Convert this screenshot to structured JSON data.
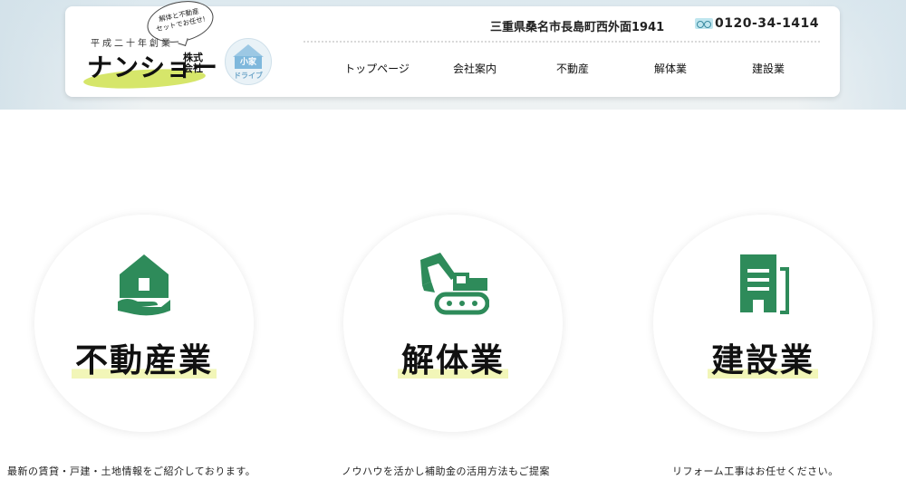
{
  "header": {
    "established": "平成二十年創業",
    "logo_name": "ナンショー",
    "logo_kabu": "株式会社",
    "bubble_text": "解体と不動産\nセットでお任せ!",
    "partner_badge_main": "小家",
    "partner_badge_sub": "ドライブ",
    "address": "三重県桑名市長島町西外面1941",
    "phone": "0120-34-1414"
  },
  "nav": {
    "items": [
      {
        "label": "トップページ"
      },
      {
        "label": "会社案内"
      },
      {
        "label": "不動産"
      },
      {
        "label": "解体業"
      },
      {
        "label": "建設業"
      }
    ]
  },
  "services": [
    {
      "title": "不動産業",
      "icon": "house-hand-icon",
      "description": "最新の賃貸・戸建・土地情報をご紹介しております。"
    },
    {
      "title": "解体業",
      "icon": "excavator-icon",
      "description": "ノウハウを活かし補助金の活用方法もご提案"
    },
    {
      "title": "建設業",
      "icon": "building-icon",
      "description": "リフォーム工事はお任せください。"
    }
  ],
  "colors": {
    "accent_green": "#2e8b5a",
    "highlight_yellow": "#f2f6b8",
    "logo_swoosh": "#d6e66a"
  }
}
